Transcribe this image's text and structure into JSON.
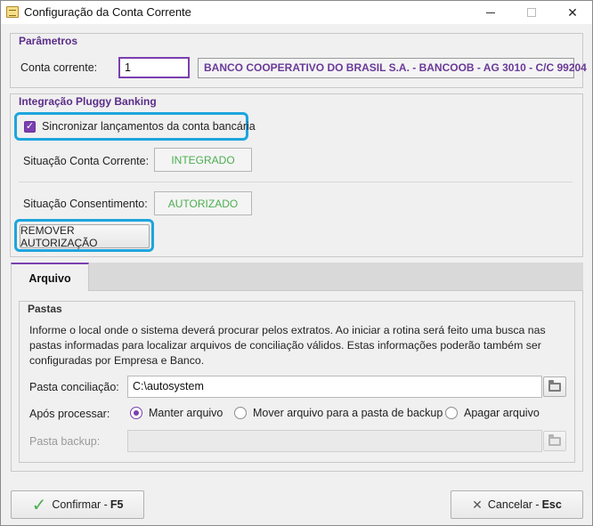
{
  "window": {
    "title": "Configuração da Conta Corrente",
    "close_glyph": "✕"
  },
  "parametros": {
    "legend": "Parâmetros",
    "conta_label": "Conta corrente:",
    "conta_value": "1",
    "bank_text": "BANCO COOPERATIVO DO BRASIL S.A. - BANCOOB - AG 3010 - C/C 99204"
  },
  "integracao": {
    "legend": "Integração Pluggy Banking",
    "sync_label": "Sincronizar lançamentos da conta bancária",
    "sync_checked": true,
    "situacao_conta_label": "Situação Conta Corrente:",
    "situacao_conta_value": "INTEGRADO",
    "situacao_consent_label": "Situação Consentimento:",
    "situacao_consent_value": "AUTORIZADO",
    "remover_label": "REMOVER AUTORIZAÇÃO",
    "status_color": "#4cae4f",
    "highlight_color": "#1ea5dd"
  },
  "tabs": [
    {
      "label": "Arquivo",
      "active": true
    }
  ],
  "pastas": {
    "legend": "Pastas",
    "description": "Informe o local onde o sistema deverá procurar pelos extratos. Ao iniciar a rotina será feito uma busca nas pastas informadas para localizar arquivos de conciliação válidos. Estas informações poderão também ser configuradas por Empresa e Banco.",
    "conciliacao_label": "Pasta conciliação:",
    "conciliacao_value": "C:\\autosystem",
    "apos_label": "Após processar:",
    "options": [
      "Manter arquivo",
      "Mover arquivo para a pasta de backup",
      "Apagar arquivo"
    ],
    "selected_option": "Manter arquivo",
    "backup_label": "Pasta backup:",
    "backup_value": ""
  },
  "footer": {
    "confirm_label": "Confirmar -",
    "confirm_key": "F5",
    "cancel_label": "Cancelar -",
    "cancel_key": "Esc"
  },
  "colors": {
    "accent": "#7a3fb0",
    "legend": "#5b2d8a"
  }
}
